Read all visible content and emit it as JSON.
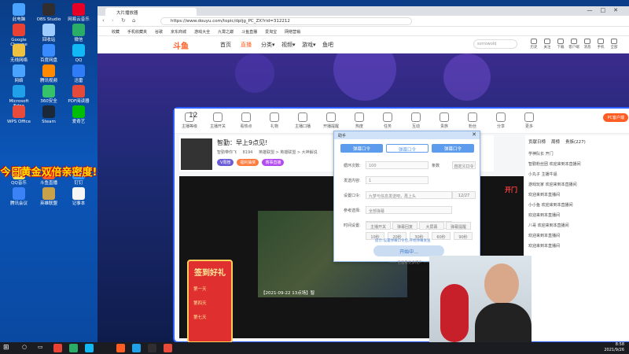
{
  "desktop": {
    "icons": [
      {
        "label": "此电脑",
        "color": "#4aa3ff"
      },
      {
        "label": "Google Chrome",
        "color": "#e94235"
      },
      {
        "label": "无线网络",
        "color": "#f0c040"
      },
      {
        "label": "网络",
        "color": "#4aa3ff"
      },
      {
        "label": "Microsoft Edge",
        "color": "#1fa0e8"
      },
      {
        "label": "WPS Office",
        "color": "#e84b3c"
      },
      {
        "label": "QQ音乐",
        "color": "#ffe14d"
      },
      {
        "label": "腾讯会议",
        "color": "#3b82f6"
      },
      {
        "label": "OBS Studio",
        "color": "#302e31"
      },
      {
        "label": "回收站",
        "color": "#9ecbff"
      },
      {
        "label": "百度网盘",
        "color": "#3a8bff"
      },
      {
        "label": "腾讯视频",
        "color": "#ff8a00"
      },
      {
        "label": "360安全",
        "color": "#36c26b"
      },
      {
        "label": "Steam",
        "color": "#1b2838"
      },
      {
        "label": "斗鱼直播",
        "color": "#ff5d23"
      },
      {
        "label": "英雄联盟",
        "color": "#c8a24a"
      },
      {
        "label": "网易云音乐",
        "color": "#e60026"
      },
      {
        "label": "微信",
        "color": "#2aae67"
      },
      {
        "label": "QQ",
        "color": "#12b7f5"
      },
      {
        "label": "迅雷",
        "color": "#2f7cf6"
      },
      {
        "label": "PDF阅读器",
        "color": "#e34a3a"
      },
      {
        "label": "爱奇艺",
        "color": "#00be06"
      },
      {
        "label": "钉钉",
        "color": "#3296fa"
      },
      {
        "label": "记事本",
        "color": "#f5f5f5"
      }
    ],
    "promo_text": "今日黄金双倍亲密度!"
  },
  "taskbar": {
    "time": "8:58",
    "date": "2021/9/26"
  },
  "browser": {
    "tab_title": "大片播放器",
    "url": "https://www.douyu.com/topic/dpljg_PC_ZX?rid=312212",
    "bookmarks": [
      "收藏",
      "手机收藏夹",
      "谷歌",
      "京东商城",
      "游戏大全",
      "九霄之巅",
      "斗鱼直播",
      "爱淘宝",
      "网络营销"
    ]
  },
  "site": {
    "logo": "斗鱼",
    "nav": [
      "首页",
      "直播",
      "分类▾",
      "视频▾",
      "游戏▾",
      "鱼吧"
    ],
    "search_placeholder": "sorrowold",
    "header_icons": [
      "历史",
      "关注",
      "下载",
      "客户端",
      "消息",
      "手机",
      "全部"
    ]
  },
  "room": {
    "rank_num": "12",
    "tools": [
      "主播等级",
      "主播开关",
      "看热点",
      "礼物",
      "主播口播",
      "开播提醒",
      "热度",
      "任务",
      "互动",
      "贵族",
      "粉丝",
      "分享",
      "更多"
    ],
    "pc_btn": "PC客户端",
    "stream_title": "智勤：早上9点见!",
    "streamer_name": "智勤带你飞",
    "streamer_id": "8194",
    "room_tags": "英雄联盟 > 英雄联盟 > 大神解说",
    "badges": [
      "V周榜",
      "福利抽奖",
      "赛事直播"
    ],
    "follow": "关注",
    "video_caption": "【2021-09-22 13点场】智",
    "open_door": "开门",
    "panel_tabs": [
      "贡献日榜",
      "周榜",
      "贵族(227)"
    ],
    "chats": [
      "学神队长 开门",
      "智勤粉丝团 欢迎来到本直播间",
      "小丸子 主播牛逼",
      "游戏玩家 欢迎来到本直播间",
      "欢迎来到本直播间",
      "小小鱼 欢迎来到本直播间",
      "欢迎来到本直播间",
      "八哥 欢迎来到本直播间",
      "欢迎来到本直播间",
      "欢迎来到本直播间"
    ],
    "sign_title": "签到好礼",
    "sign_days": [
      "第一天",
      "第四天",
      "第七天"
    ]
  },
  "popup": {
    "title": "助手",
    "tabs": [
      "弹幕口令",
      "弹幕口令",
      "弹幕口令"
    ],
    "rows": [
      {
        "label": "循环次数:",
        "value": "100",
        "unit": "条数",
        "btn": "自定义口令"
      },
      {
        "label": "发送内容:",
        "value": "1",
        "unit": "",
        "btn": ""
      },
      {
        "label": "设置口令:",
        "value": "九梦与信息发送吧，再上头",
        "unit": "",
        "btn": "12/27"
      },
      {
        "label": "参考选择:",
        "value": "全部弹幕",
        "unit": "",
        "btn": ""
      },
      {
        "label": "时间设置:",
        "value": "10秒",
        "unit": "",
        "btn": ""
      }
    ],
    "opts": [
      "主播开关",
      "弹幕回复",
      "大屏幕",
      "弹幕提醒"
    ],
    "times": [
      "10秒",
      "20秒",
      "30秒",
      "60秒",
      "90秒"
    ],
    "hint": "提示:设置弹幕口令后,开始弹幕发送",
    "start": "开始中...",
    "footer": "—— 已查看更多用户 ——"
  }
}
